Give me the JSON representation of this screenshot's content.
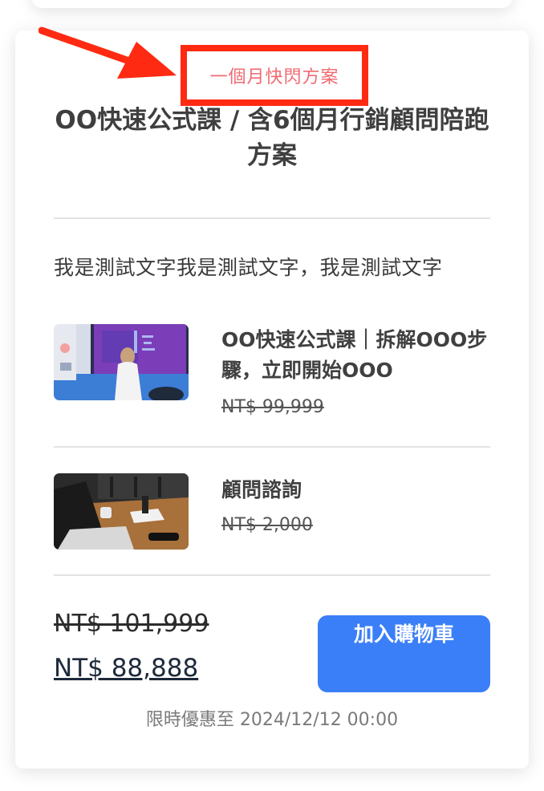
{
  "plan": {
    "tag": "一個月快閃方案",
    "title": "OO快速公式課 / 含6個月行銷顧問陪跑方案",
    "description": "我是測試文字我是測試文字，我是測試文字"
  },
  "items": [
    {
      "name": "OO快速公式課｜拆解OOO步驟，立即開始OOO",
      "price": "NT$ 99,999"
    },
    {
      "name": "顧問諮詢",
      "price": "NT$ 2,000"
    }
  ],
  "pricing": {
    "original_total": "NT$ 101,999",
    "sale_total": "NT$ 88,888"
  },
  "actions": {
    "add_to_cart_label": "加入購物車"
  },
  "promo": {
    "deadline_text": "限時優惠至 2024/12/12 00:00"
  },
  "colors": {
    "accent_button": "#3a7ff7",
    "tag_text": "#ef6b72",
    "annotation_red": "#ff2a12"
  },
  "icons": {
    "annotation": "arrow-pointer-icon"
  }
}
